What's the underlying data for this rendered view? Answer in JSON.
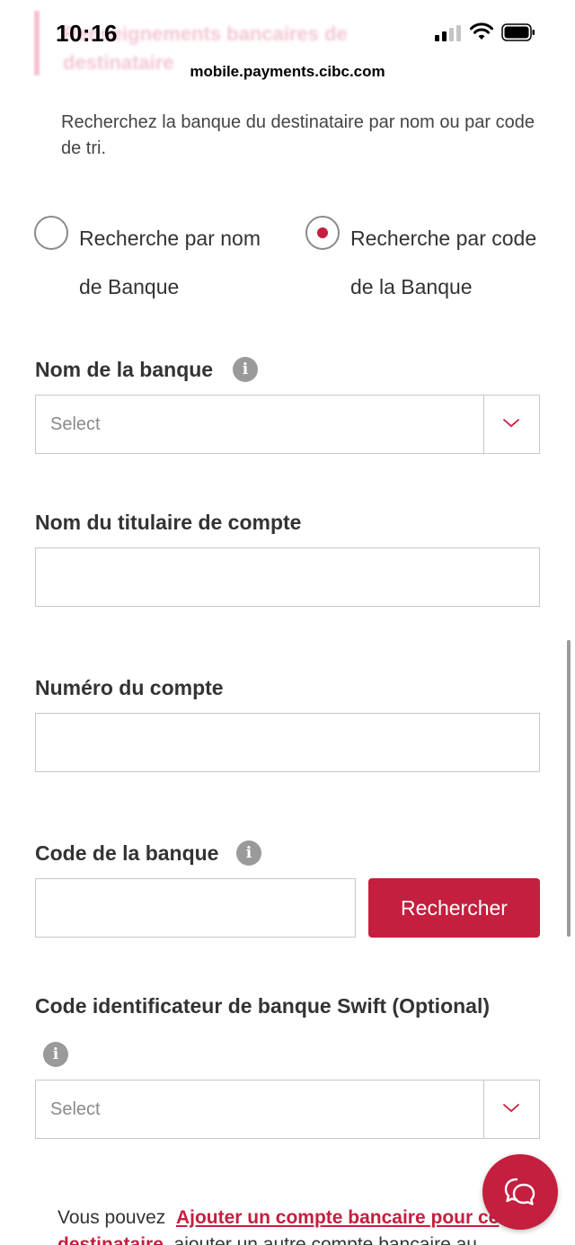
{
  "status_bar": {
    "time": "10:16",
    "url": "mobile.payments.cibc.com",
    "faded_heading": "Renseignements bancaires de destinataire"
  },
  "intro_text": "Recherchez la banque du destinataire par nom ou par code de tri.",
  "search_mode": {
    "options": [
      {
        "label": "Recherche par nom de Banque",
        "selected": false
      },
      {
        "label": "Recherche par code de la Banque",
        "selected": true
      }
    ]
  },
  "bank_name": {
    "label": "Nom de la banque",
    "select_value": "Select"
  },
  "account_holder": {
    "label": "Nom du titulaire de compte",
    "value": ""
  },
  "account_number": {
    "label": "Numéro du compte",
    "value": ""
  },
  "bank_code": {
    "label": "Code de la banque",
    "value": "",
    "search_button": "Rechercher"
  },
  "swift_code": {
    "label": "Code identificateur de banque Swift (Optional)",
    "select_value": "Select"
  },
  "footer": {
    "prefix": "Vous pouvez",
    "link": "Ajouter un compte bancaire pour ce destinataire",
    "suffix": ", ajouter un autre compte bancaire au"
  },
  "icons": {
    "info": "info-icon",
    "chevron": "chevron-down-icon",
    "chat": "chat-icon"
  },
  "colors": {
    "accent": "#c41f3e",
    "border": "#c8c8c8",
    "info_icon": "#9a9a9a"
  }
}
